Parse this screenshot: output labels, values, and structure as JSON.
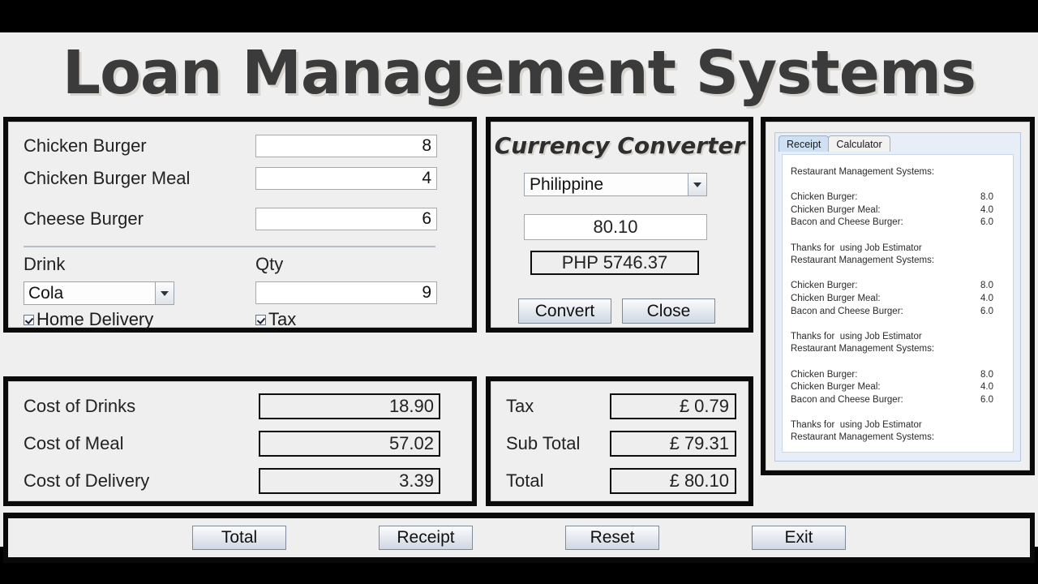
{
  "window": {
    "title": "Loan Management Systems"
  },
  "order_panel": {
    "items": [
      {
        "label": "Chicken Burger",
        "qty": "8"
      },
      {
        "label": "Chicken Burger Meal",
        "qty": "4"
      },
      {
        "label": "Cheese Burger",
        "qty": "6"
      }
    ],
    "drink_header": "Drink",
    "qty_header": "Qty",
    "drink_selected": "Cola",
    "drink_qty": "9",
    "home_delivery_label": "Home Delivery",
    "home_delivery_checked": true,
    "tax_label": "Tax",
    "tax_checked": true
  },
  "currency_converter": {
    "title": "Currency Converter",
    "currency_selected": "Philippine",
    "amount": "80.10",
    "converted": "PHP 5746.37",
    "convert_label": "Convert",
    "close_label": "Close"
  },
  "receipt_panel": {
    "tabs": [
      {
        "label": "Receipt",
        "active": true
      },
      {
        "label": "Calculator",
        "active": false
      }
    ],
    "lines": [
      {
        "text": "Restaurant Management Systems:",
        "amount": ""
      },
      {
        "text": "",
        "amount": ""
      },
      {
        "text": "Chicken Burger:",
        "amount": "8.0"
      },
      {
        "text": "Chicken Burger Meal:",
        "amount": "4.0"
      },
      {
        "text": "Bacon and Cheese Burger:",
        "amount": "6.0"
      },
      {
        "text": "",
        "amount": ""
      },
      {
        "text": "Thanks for  using Job Estimator",
        "amount": ""
      },
      {
        "text": "Restaurant Management Systems:",
        "amount": ""
      },
      {
        "text": "",
        "amount": ""
      },
      {
        "text": "Chicken Burger:",
        "amount": "8.0"
      },
      {
        "text": "Chicken Burger Meal:",
        "amount": "4.0"
      },
      {
        "text": "Bacon and Cheese Burger:",
        "amount": "6.0"
      },
      {
        "text": "",
        "amount": ""
      },
      {
        "text": "Thanks for  using Job Estimator",
        "amount": ""
      },
      {
        "text": "Restaurant Management Systems:",
        "amount": ""
      },
      {
        "text": "",
        "amount": ""
      },
      {
        "text": "Chicken Burger:",
        "amount": "8.0"
      },
      {
        "text": "Chicken Burger Meal:",
        "amount": "4.0"
      },
      {
        "text": "Bacon and Cheese Burger:",
        "amount": "6.0"
      },
      {
        "text": "",
        "amount": ""
      },
      {
        "text": "Thanks for  using Job Estimator",
        "amount": ""
      },
      {
        "text": "Restaurant Management Systems:",
        "amount": ""
      }
    ]
  },
  "cost_panel": {
    "rows": [
      {
        "label": "Cost of Drinks",
        "value": "18.90"
      },
      {
        "label": "Cost of Meal",
        "value": "57.02"
      },
      {
        "label": "Cost of Delivery",
        "value": "3.39"
      }
    ]
  },
  "totals_panel": {
    "rows": [
      {
        "label": "Tax",
        "value": "£ 0.79"
      },
      {
        "label": "Sub Total",
        "value": "£ 79.31"
      },
      {
        "label": "Total",
        "value": "£ 80.10"
      }
    ]
  },
  "action_bar": {
    "buttons": [
      {
        "label": "Total"
      },
      {
        "label": "Receipt"
      },
      {
        "label": "Reset"
      },
      {
        "label": "Exit"
      }
    ]
  },
  "colors": {
    "panel_border": "#0a0a0a",
    "app_background": "#efefef",
    "letterbox": "#000000",
    "title_text": "#3b3b3b",
    "tab_active": "#cfe0f3"
  }
}
